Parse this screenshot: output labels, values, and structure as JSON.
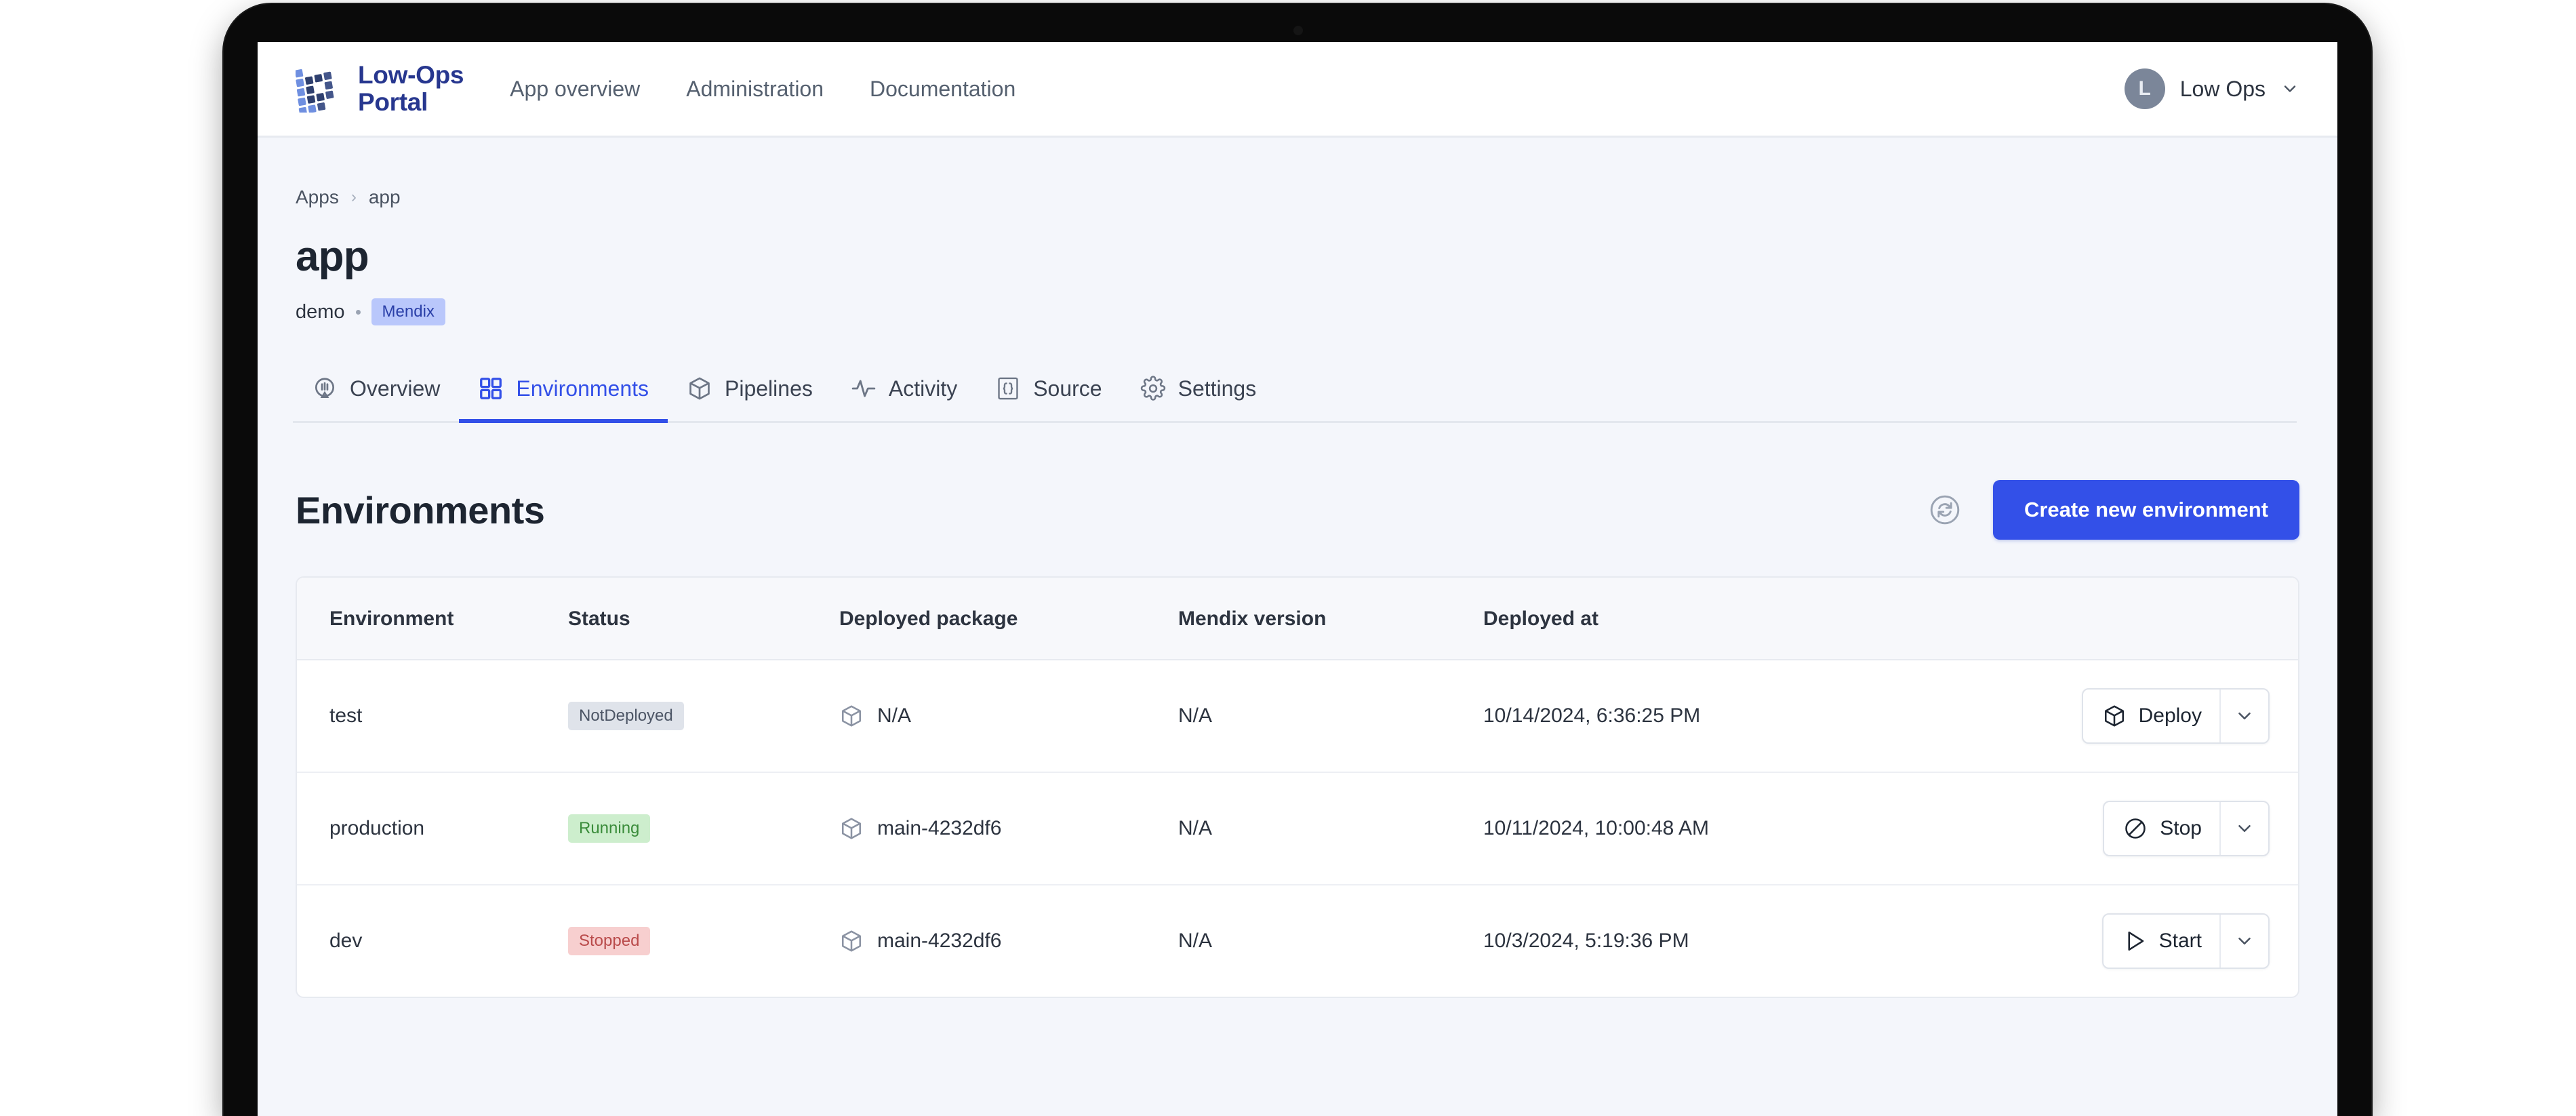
{
  "brand": {
    "name_line1": "Low-Ops",
    "name_line2": "Portal",
    "logo_icon": "grid-squares-logo-icon"
  },
  "topnav": {
    "links": [
      {
        "label": "App overview"
      },
      {
        "label": "Administration"
      },
      {
        "label": "Documentation"
      }
    ],
    "user": {
      "avatar_initial": "L",
      "name": "Low Ops",
      "caret_icon": "chevron-down-icon"
    }
  },
  "breadcrumb": {
    "items": [
      {
        "label": "Apps"
      },
      {
        "label": "app"
      }
    ],
    "separator": "›"
  },
  "header": {
    "title": "app",
    "owner": "demo",
    "platform_chip": "Mendix"
  },
  "tabs": [
    {
      "label": "Overview",
      "icon": "compass-icon",
      "active": false
    },
    {
      "label": "Environments",
      "icon": "grid-four-icon",
      "active": true
    },
    {
      "label": "Pipelines",
      "icon": "package-icon",
      "active": false
    },
    {
      "label": "Activity",
      "icon": "pulse-icon",
      "active": false
    },
    {
      "label": "Source",
      "icon": "code-braces-icon",
      "active": false
    },
    {
      "label": "Settings",
      "icon": "gear-icon",
      "active": false
    }
  ],
  "section": {
    "title": "Environments",
    "refresh_icon": "refresh-icon",
    "create_button": "Create new environment"
  },
  "table": {
    "columns": [
      "Environment",
      "Status",
      "Deployed package",
      "Mendix version",
      "Deployed at",
      ""
    ],
    "rows": [
      {
        "environment": "test",
        "status": "NotDeployed",
        "status_kind": "notdeployed",
        "package": "N/A",
        "package_icon": "package-icon",
        "mendix_version": "N/A",
        "deployed_at": "10/14/2024, 6:36:25 PM",
        "action_label": "Deploy",
        "action_icon": "package-icon",
        "caret_icon": "chevron-down-icon"
      },
      {
        "environment": "production",
        "status": "Running",
        "status_kind": "running",
        "package": "main-4232df6",
        "package_icon": "package-icon",
        "mendix_version": "N/A",
        "deployed_at": "10/11/2024, 10:00:48 AM",
        "action_label": "Stop",
        "action_icon": "stop-circle-icon",
        "caret_icon": "chevron-down-icon"
      },
      {
        "environment": "dev",
        "status": "Stopped",
        "status_kind": "stopped",
        "package": "main-4232df6",
        "package_icon": "package-icon",
        "mendix_version": "N/A",
        "deployed_at": "10/3/2024, 5:19:36 PM",
        "action_label": "Start",
        "action_icon": "play-icon",
        "caret_icon": "chevron-down-icon"
      }
    ]
  },
  "colors": {
    "accent": "#3350e8",
    "brand_text": "#27378f",
    "page_bg": "#f4f6fb",
    "running": "#cdeecd",
    "stopped": "#f7cfcf",
    "notdeployed": "#dfe3ea"
  }
}
